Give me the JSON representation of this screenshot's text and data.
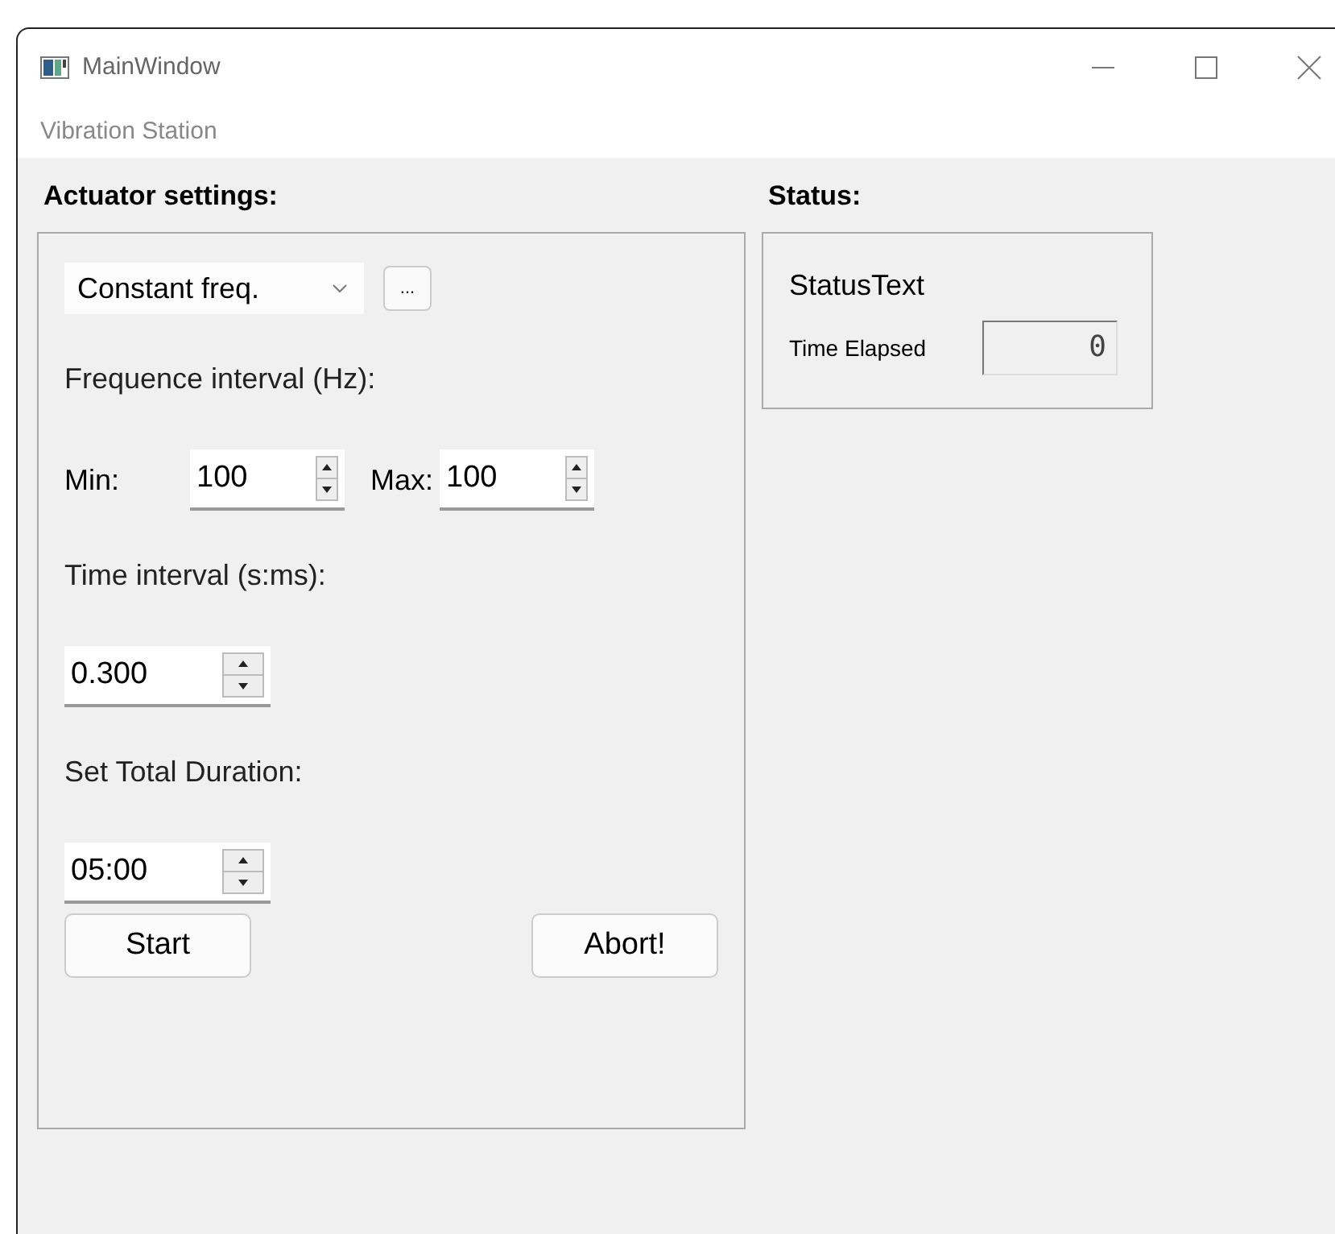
{
  "window": {
    "title": "MainWindow"
  },
  "menu": [
    "Vibration Station"
  ],
  "actuator": {
    "heading": "Actuator settings:",
    "mode": {
      "value": "Constant freq."
    },
    "more_button": "...",
    "freq_label": "Frequence interval (Hz):",
    "min_label": "Min:",
    "min_value": "100",
    "max_label": "Max:",
    "max_value": "100",
    "time_label": "Time interval (s:ms):",
    "time_value": "0.300",
    "duration_label": "Set Total Duration:",
    "duration_value": "05:00",
    "start_button": "Start",
    "abort_button": "Abort!"
  },
  "status": {
    "heading": "Status:",
    "text": "StatusText",
    "elapsed_label": "Time Elapsed",
    "elapsed_value": "0"
  }
}
